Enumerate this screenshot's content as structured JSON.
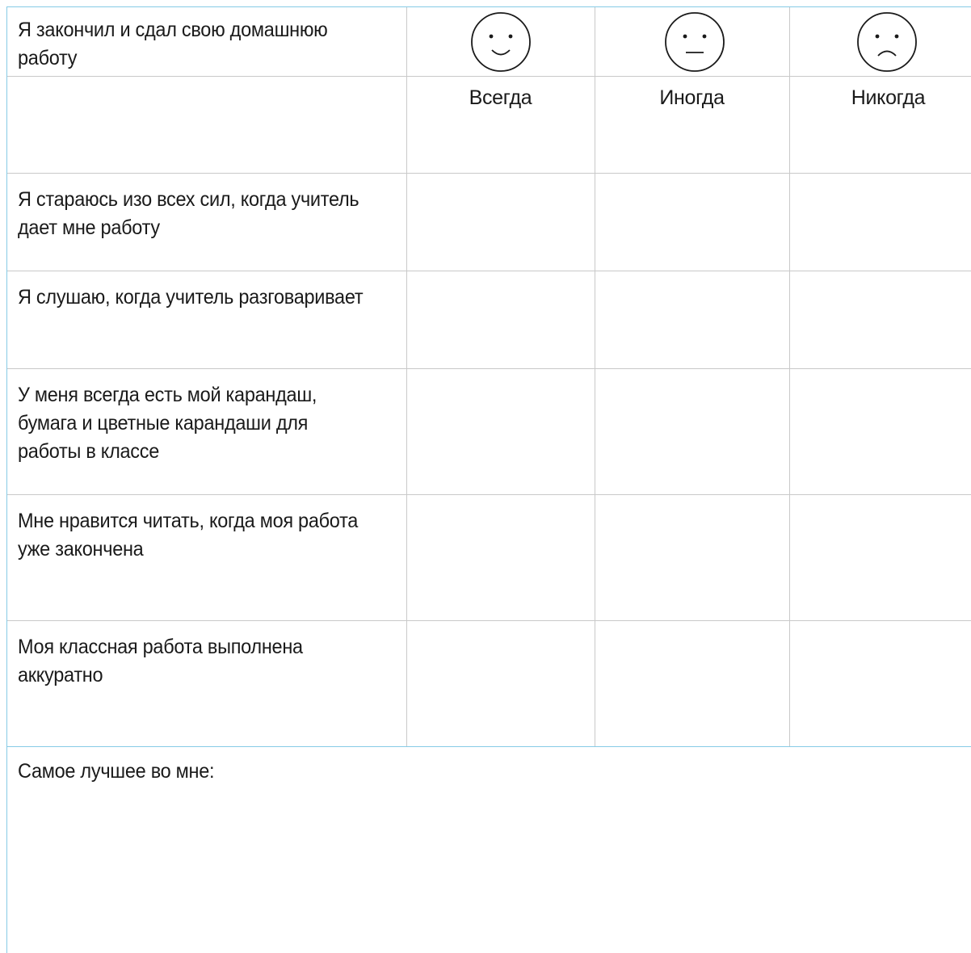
{
  "columns": {
    "always": {
      "label": "Всегда",
      "icon": "smiling-face-icon"
    },
    "sometimes": {
      "label": "Иногда",
      "icon": "neutral-face-icon"
    },
    "never": {
      "label": "Никогда",
      "icon": "sad-face-icon"
    }
  },
  "rows": [
    "Я закончил и сдал свою домашнюю работу",
    "Я стараюсь изо всех сил, когда учитель дает мне работу",
    "Я слушаю, когда учитель разговаривает",
    "У меня всегда есть мой карандаш, бумага и цветные карандаши для работы в классе",
    "Мне нравится читать, когда моя работа уже закончена",
    "Моя классная работа выполнена аккуратно"
  ],
  "footer": {
    "label": "Самое лучшее во мне:"
  },
  "colors": {
    "border": "#86cbe6",
    "grid": "#c9c9c9"
  }
}
